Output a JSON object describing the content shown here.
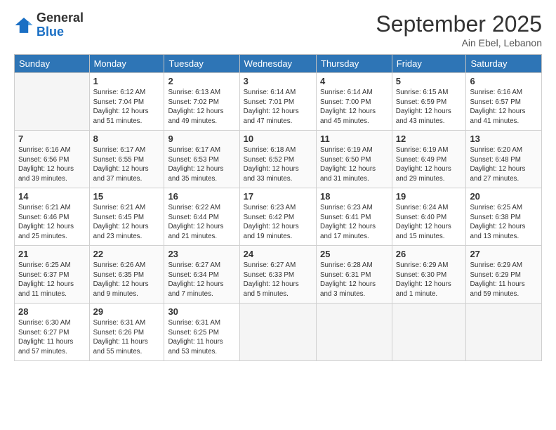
{
  "header": {
    "logo_general": "General",
    "logo_blue": "Blue",
    "month_year": "September 2025",
    "location": "Ain Ebel, Lebanon"
  },
  "days_of_week": [
    "Sunday",
    "Monday",
    "Tuesday",
    "Wednesday",
    "Thursday",
    "Friday",
    "Saturday"
  ],
  "weeks": [
    [
      {
        "day": "",
        "info": ""
      },
      {
        "day": "1",
        "info": "Sunrise: 6:12 AM\nSunset: 7:04 PM\nDaylight: 12 hours\nand 51 minutes."
      },
      {
        "day": "2",
        "info": "Sunrise: 6:13 AM\nSunset: 7:02 PM\nDaylight: 12 hours\nand 49 minutes."
      },
      {
        "day": "3",
        "info": "Sunrise: 6:14 AM\nSunset: 7:01 PM\nDaylight: 12 hours\nand 47 minutes."
      },
      {
        "day": "4",
        "info": "Sunrise: 6:14 AM\nSunset: 7:00 PM\nDaylight: 12 hours\nand 45 minutes."
      },
      {
        "day": "5",
        "info": "Sunrise: 6:15 AM\nSunset: 6:59 PM\nDaylight: 12 hours\nand 43 minutes."
      },
      {
        "day": "6",
        "info": "Sunrise: 6:16 AM\nSunset: 6:57 PM\nDaylight: 12 hours\nand 41 minutes."
      }
    ],
    [
      {
        "day": "7",
        "info": "Sunrise: 6:16 AM\nSunset: 6:56 PM\nDaylight: 12 hours\nand 39 minutes."
      },
      {
        "day": "8",
        "info": "Sunrise: 6:17 AM\nSunset: 6:55 PM\nDaylight: 12 hours\nand 37 minutes."
      },
      {
        "day": "9",
        "info": "Sunrise: 6:17 AM\nSunset: 6:53 PM\nDaylight: 12 hours\nand 35 minutes."
      },
      {
        "day": "10",
        "info": "Sunrise: 6:18 AM\nSunset: 6:52 PM\nDaylight: 12 hours\nand 33 minutes."
      },
      {
        "day": "11",
        "info": "Sunrise: 6:19 AM\nSunset: 6:50 PM\nDaylight: 12 hours\nand 31 minutes."
      },
      {
        "day": "12",
        "info": "Sunrise: 6:19 AM\nSunset: 6:49 PM\nDaylight: 12 hours\nand 29 minutes."
      },
      {
        "day": "13",
        "info": "Sunrise: 6:20 AM\nSunset: 6:48 PM\nDaylight: 12 hours\nand 27 minutes."
      }
    ],
    [
      {
        "day": "14",
        "info": "Sunrise: 6:21 AM\nSunset: 6:46 PM\nDaylight: 12 hours\nand 25 minutes."
      },
      {
        "day": "15",
        "info": "Sunrise: 6:21 AM\nSunset: 6:45 PM\nDaylight: 12 hours\nand 23 minutes."
      },
      {
        "day": "16",
        "info": "Sunrise: 6:22 AM\nSunset: 6:44 PM\nDaylight: 12 hours\nand 21 minutes."
      },
      {
        "day": "17",
        "info": "Sunrise: 6:23 AM\nSunset: 6:42 PM\nDaylight: 12 hours\nand 19 minutes."
      },
      {
        "day": "18",
        "info": "Sunrise: 6:23 AM\nSunset: 6:41 PM\nDaylight: 12 hours\nand 17 minutes."
      },
      {
        "day": "19",
        "info": "Sunrise: 6:24 AM\nSunset: 6:40 PM\nDaylight: 12 hours\nand 15 minutes."
      },
      {
        "day": "20",
        "info": "Sunrise: 6:25 AM\nSunset: 6:38 PM\nDaylight: 12 hours\nand 13 minutes."
      }
    ],
    [
      {
        "day": "21",
        "info": "Sunrise: 6:25 AM\nSunset: 6:37 PM\nDaylight: 12 hours\nand 11 minutes."
      },
      {
        "day": "22",
        "info": "Sunrise: 6:26 AM\nSunset: 6:35 PM\nDaylight: 12 hours\nand 9 minutes."
      },
      {
        "day": "23",
        "info": "Sunrise: 6:27 AM\nSunset: 6:34 PM\nDaylight: 12 hours\nand 7 minutes."
      },
      {
        "day": "24",
        "info": "Sunrise: 6:27 AM\nSunset: 6:33 PM\nDaylight: 12 hours\nand 5 minutes."
      },
      {
        "day": "25",
        "info": "Sunrise: 6:28 AM\nSunset: 6:31 PM\nDaylight: 12 hours\nand 3 minutes."
      },
      {
        "day": "26",
        "info": "Sunrise: 6:29 AM\nSunset: 6:30 PM\nDaylight: 12 hours\nand 1 minute."
      },
      {
        "day": "27",
        "info": "Sunrise: 6:29 AM\nSunset: 6:29 PM\nDaylight: 11 hours\nand 59 minutes."
      }
    ],
    [
      {
        "day": "28",
        "info": "Sunrise: 6:30 AM\nSunset: 6:27 PM\nDaylight: 11 hours\nand 57 minutes."
      },
      {
        "day": "29",
        "info": "Sunrise: 6:31 AM\nSunset: 6:26 PM\nDaylight: 11 hours\nand 55 minutes."
      },
      {
        "day": "30",
        "info": "Sunrise: 6:31 AM\nSunset: 6:25 PM\nDaylight: 11 hours\nand 53 minutes."
      },
      {
        "day": "",
        "info": ""
      },
      {
        "day": "",
        "info": ""
      },
      {
        "day": "",
        "info": ""
      },
      {
        "day": "",
        "info": ""
      }
    ]
  ]
}
